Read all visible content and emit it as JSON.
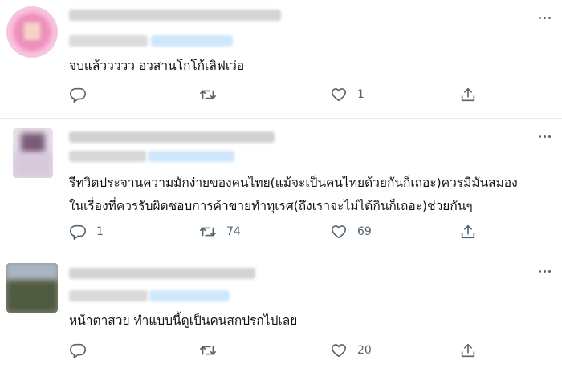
{
  "tweets": [
    {
      "text": "จบแล้ววววว อวสานโกโก้เลิฟเว่อ",
      "reply_count": "",
      "retweet_count": "",
      "like_count": "1"
    },
    {
      "text_line1": "รีทวิตประจานความมักง่ายของคนไทย(แม้จะเป็นคนไทยด้วยกันก็เถอะ)ควรมีมันสมอง",
      "text_line2": "ในเรื่องที่ควรรับผิดชอบการค้าขายทำทุเรศ(ถึงเราจะไม่ได้กินก็เถอะ)ช่วยกันๆ",
      "reply_count": "1",
      "retweet_count": "74",
      "like_count": "69"
    },
    {
      "text": "หน้าตาสวย ทำแบบนี้ดูเป็นคนสกปรกไปเลย",
      "reply_count": "",
      "retweet_count": "",
      "like_count": "20"
    }
  ],
  "icons": {
    "reply": "reply-icon",
    "retweet": "retweet-icon",
    "like": "heart-icon",
    "share": "share-icon",
    "more": "more-icon"
  },
  "colors": {
    "icon_gray": "#536471",
    "divider": "#e6ecf0",
    "handle_blue": "#1d9bf0"
  }
}
